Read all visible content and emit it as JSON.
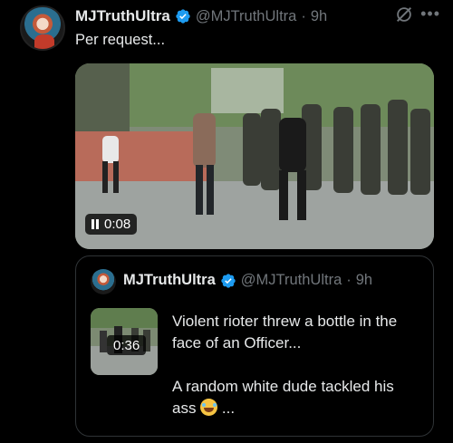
{
  "tweet": {
    "display_name": "MJTruthUltra",
    "handle": "@MJTruthUltra",
    "separator": "·",
    "time": "9h",
    "text": "Per request...",
    "video_duration": "0:08"
  },
  "quoted_tweet": {
    "display_name": "MJTruthUltra",
    "handle": "@MJTruthUltra",
    "separator": "·",
    "time": "9h",
    "video_duration": "0:36",
    "text_line1": "Violent rioter threw a bottle in the face of an Officer...",
    "text_line2": "A random white dude tackled his ass",
    "text_line2_end": " ..."
  },
  "icons": {
    "verified": "verified-badge-icon",
    "grok": "grok-icon",
    "more": "more-dots-icon",
    "pause": "pause-icon",
    "emoji": "rolling-on-floor-laughing-emoji"
  },
  "colors": {
    "background": "#000000",
    "verified": "#1d9bf0",
    "secondary_text": "#71767b",
    "border": "#2f3336"
  }
}
